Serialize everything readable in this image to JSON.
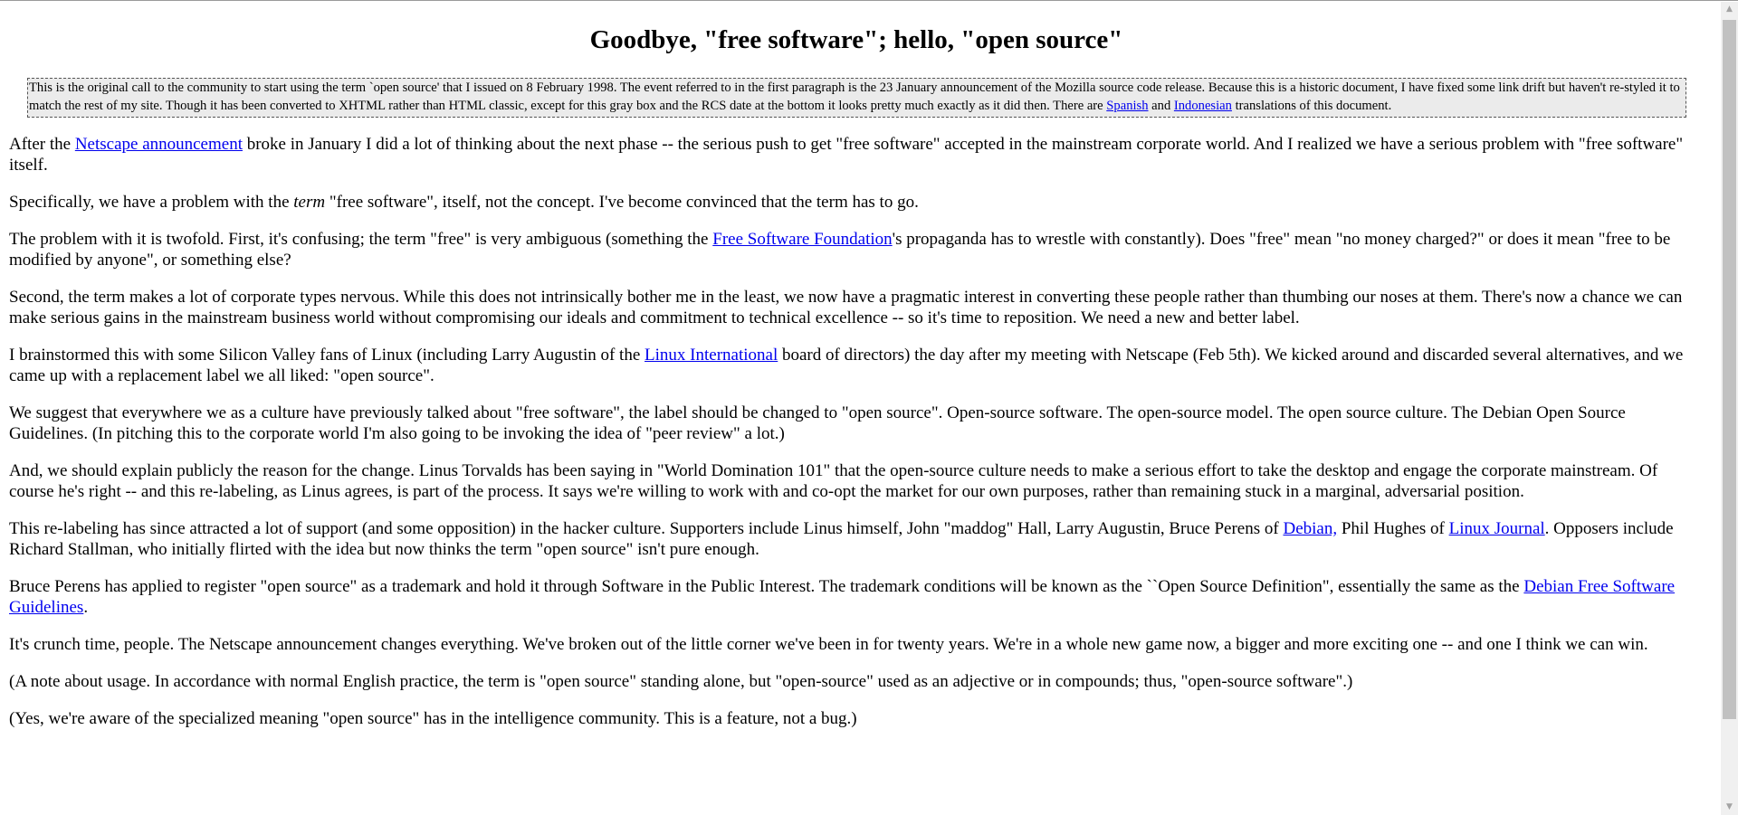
{
  "title": "Goodbye, \"free software\"; hello, \"open source\"",
  "notice": {
    "text_1": "This is the original call to the community to start using the term `open source' that I issued on 8 February 1998. The event referred to in the first paragraph is the 23 January announcement of the Mozilla source code release. Because this is a historic document, I have fixed some link drift but haven't re-styled it to match the rest of my site. Though it has been converted to XHTML rather than HTML classic, except for this gray box and the RCS date at the bottom it looks pretty much exactly as it did then. There are ",
    "link_spanish": "Spanish",
    "text_2": " and ",
    "link_indonesian": "Indonesian",
    "text_3": " translations of this document."
  },
  "p1": {
    "text_1": "After the ",
    "link": "Netscape announcement",
    "text_2": " broke in January I did a lot of thinking about the next phase -- the serious push to get \"free software\" accepted in the mainstream corporate world. And I realized we have a serious problem with \"free software\" itself."
  },
  "p2": {
    "text_1": "Specifically, we have a problem with the ",
    "em": "term",
    "text_2": " \"free software\", itself, not the concept. I've become convinced that the term has to go."
  },
  "p3": {
    "text_1": "The problem with it is twofold. First, it's confusing; the term \"free\" is very ambiguous (something the ",
    "link": "Free Software Foundation",
    "text_2": "'s propaganda has to wrestle with constantly). Does \"free\" mean \"no money charged?\" or does it mean \"free to be modified by anyone\", or something else?"
  },
  "p4": {
    "text": "Second, the term makes a lot of corporate types nervous. While this does not intrinsically bother me in the least, we now have a pragmatic interest in converting these people rather than thumbing our noses at them. There's now a chance we can make serious gains in the mainstream business world without compromising our ideals and commitment to technical excellence -- so it's time to reposition. We need a new and better label."
  },
  "p5": {
    "text_1": "I brainstormed this with some Silicon Valley fans of Linux (including Larry Augustin of the ",
    "link": "Linux International",
    "text_2": " board of directors) the day after my meeting with Netscape (Feb 5th). We kicked around and discarded several alternatives, and we came up with a replacement label we all liked: \"open source\"."
  },
  "p6": {
    "text": "We suggest that everywhere we as a culture have previously talked about \"free software\", the label should be changed to \"open source\". Open-source software. The open-source model. The open source culture. The Debian Open Source Guidelines. (In pitching this to the corporate world I'm also going to be invoking the idea of \"peer review\" a lot.)"
  },
  "p7": {
    "text": "And, we should explain publicly the reason for the change. Linus Torvalds has been saying in \"World Domination 101\" that the open-source culture needs to make a serious effort to take the desktop and engage the corporate mainstream. Of course he's right -- and this re-labeling, as Linus agrees, is part of the process. It says we're willing to work with and co-opt the market for our own purposes, rather than remaining stuck in a marginal, adversarial position."
  },
  "p8": {
    "text_1": "This re-labeling has since attracted a lot of support (and some opposition) in the hacker culture. Supporters include Linus himself, John \"maddog\" Hall, Larry Augustin, Bruce Perens of ",
    "link_debian": "Debian,",
    "text_2": " Phil Hughes of ",
    "link_lj": "Linux Journal",
    "text_3": ". Opposers include Richard Stallman, who initially flirted with the idea but now thinks the term \"open source\" isn't pure enough."
  },
  "p9": {
    "text_1": "Bruce Perens has applied to register \"open source\" as a trademark and hold it through Software in the Public Interest. The trademark conditions will be known as the ``Open Source Definition\", essentially the same as the ",
    "link": "Debian Free Software Guidelines",
    "text_2": "."
  },
  "p10": {
    "text": "It's crunch time, people. The Netscape announcement changes everything. We've broken out of the little corner we've been in for twenty years. We're in a whole new game now, a bigger and more exciting one -- and one I think we can win."
  },
  "p11": {
    "text": "(A note about usage. In accordance with normal English practice, the term is \"open source\" standing alone, but \"open-source\" used as an adjective or in compounds; thus, \"open-source software\".)"
  },
  "p12": {
    "text": "(Yes, we're aware of the specialized meaning \"open source\" has in the intelligence community. This is a feature, not a bug.)"
  },
  "scrollbar": {
    "up_icon": "scroll-up-arrow",
    "down_icon": "scroll-down-arrow"
  },
  "colors": {
    "link": "#0000ee",
    "notice_background": "#ebebeb",
    "text": "#000000"
  }
}
